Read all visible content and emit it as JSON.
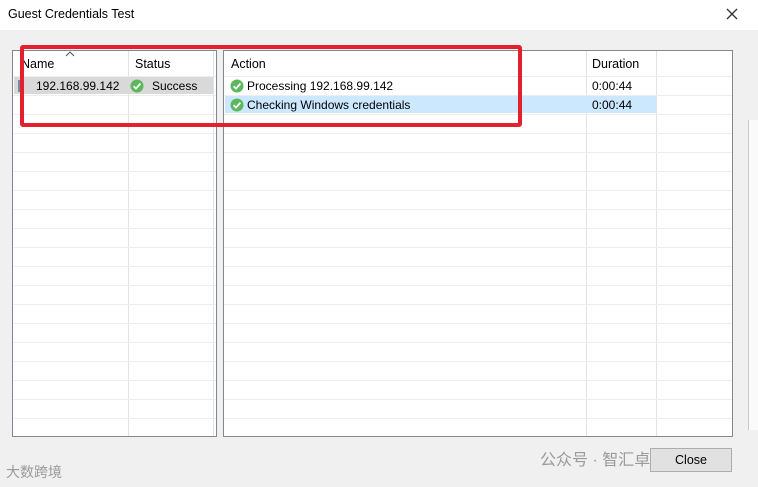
{
  "window": {
    "title": "Guest Credentials Test"
  },
  "left_list": {
    "columns": [
      "Name",
      "Status"
    ],
    "rows": [
      {
        "name": "192.168.99.142",
        "status": "Success",
        "status_icon": "check-circle-icon"
      }
    ]
  },
  "right_list": {
    "columns": [
      "Action",
      "Duration"
    ],
    "rows": [
      {
        "action": "Processing 192.168.99.142",
        "duration": "0:00:44",
        "icon": "check-circle-icon"
      },
      {
        "action": "Checking Windows credentials",
        "duration": "0:00:44",
        "icon": "check-circle-icon"
      }
    ]
  },
  "footer": {
    "close_label": "Close"
  },
  "watermarks": {
    "bottom_left": "大数跨境",
    "bottom_right": "公众号 · 智汇卓云"
  },
  "colors": {
    "success_green": "#5cb85c",
    "selection_blue": "#cce8ff",
    "annotation_red": "#e3202d"
  }
}
